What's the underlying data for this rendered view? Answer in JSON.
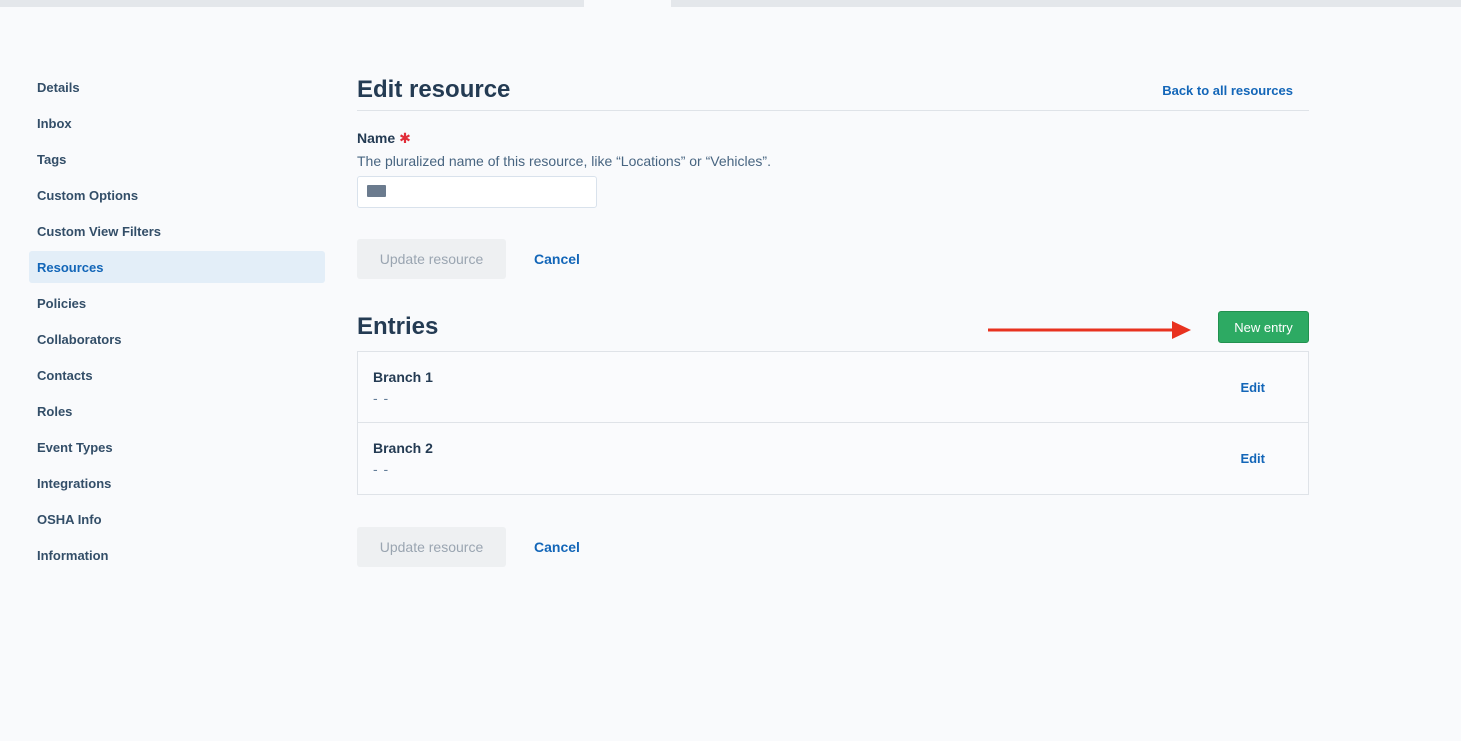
{
  "sidebar": {
    "items": [
      {
        "label": "Details"
      },
      {
        "label": "Inbox"
      },
      {
        "label": "Tags"
      },
      {
        "label": "Custom Options"
      },
      {
        "label": "Custom View Filters"
      },
      {
        "label": "Resources"
      },
      {
        "label": "Policies"
      },
      {
        "label": "Collaborators"
      },
      {
        "label": "Contacts"
      },
      {
        "label": "Roles"
      },
      {
        "label": "Event Types"
      },
      {
        "label": "Integrations"
      },
      {
        "label": "OSHA Info"
      },
      {
        "label": "Information"
      }
    ],
    "active": "Resources"
  },
  "header": {
    "title": "Edit resource",
    "back_link": "Back to all resources"
  },
  "form": {
    "name_label": "Name",
    "required_mark": "✱",
    "name_help": "The pluralized name of this resource, like “Locations” or “Vehicles”.",
    "name_value": ""
  },
  "actions": {
    "update_label": "Update resource",
    "cancel_label": "Cancel"
  },
  "entries": {
    "title": "Entries",
    "new_entry_label": "New entry",
    "items": [
      {
        "name": "Branch 1",
        "subtitle": "- -",
        "edit_label": "Edit"
      },
      {
        "name": "Branch 2",
        "subtitle": "- -",
        "edit_label": "Edit"
      }
    ]
  },
  "colors": {
    "accent": "#1366b8",
    "primary_button": "#2daa63",
    "annotation_arrow": "#e8321f",
    "active_nav_bg": "#e3eef8"
  }
}
